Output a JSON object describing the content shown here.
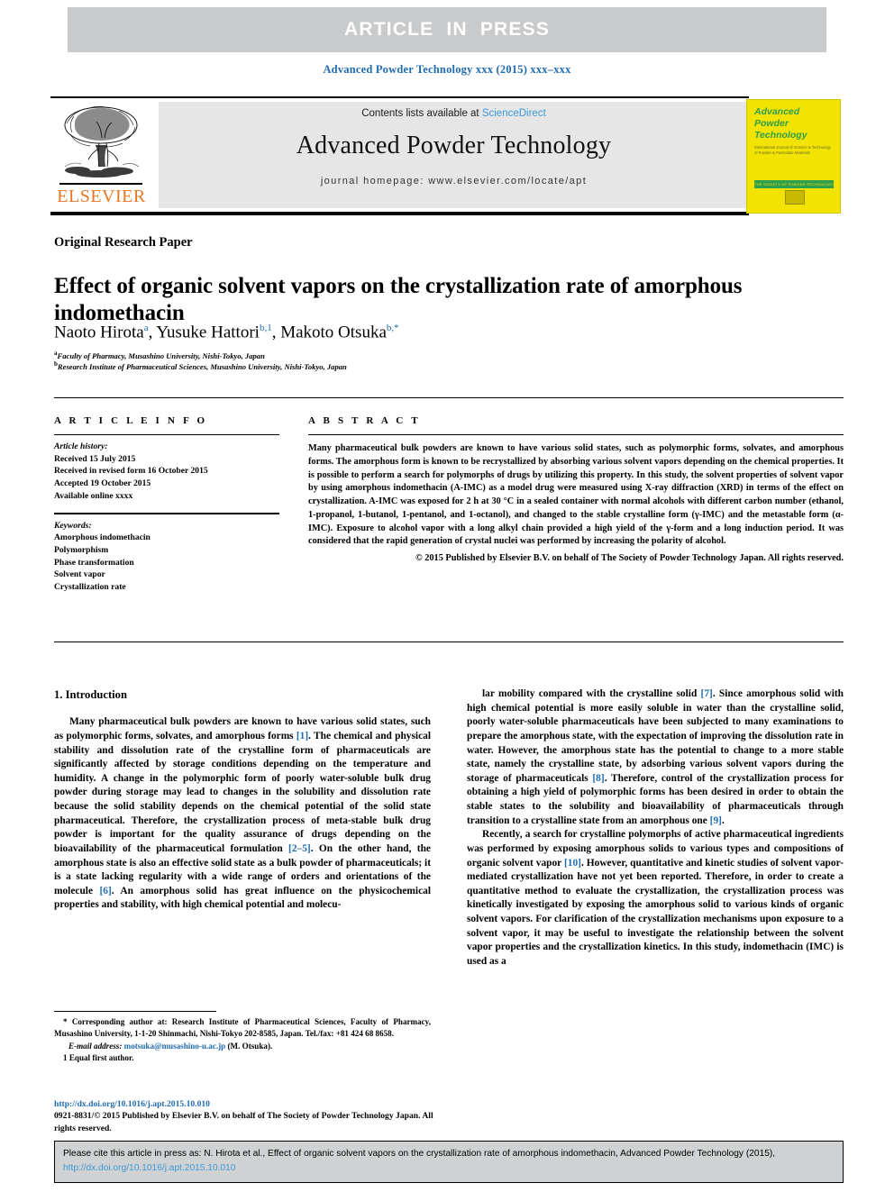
{
  "banner": {
    "text": "ARTICLE IN PRESS",
    "bg_color": "#c8cacb"
  },
  "running_head": "Advanced Powder Technology xxx (2015) xxx–xxx",
  "masthead": {
    "contents_prefix": "Contents lists available at ",
    "sciencedirect": "ScienceDirect",
    "journal_title": "Advanced Powder Technology",
    "homepage": "journal homepage: www.elsevier.com/locate/apt",
    "publisher_logo_word": "ELSEVIER",
    "publisher_color": "#e87722"
  },
  "cover": {
    "title_line1": "Advanced",
    "title_line2": "Powder",
    "title_line3": "Technology",
    "subtitle": "International Journal of Science & Technology of Powder & Particulate Materials",
    "band_text": "THE SOCIETY OF POWDER TECHNOLOGY JAPAN",
    "bg_color": "#f2e400",
    "accent_color": "#2e9e4f"
  },
  "article": {
    "kicker": "Original Research Paper",
    "title": "Effect of organic solvent vapors on the crystallization rate of amorphous indomethacin",
    "authors": [
      {
        "name": "Naoto Hirota",
        "marks": "a"
      },
      {
        "name": "Yusuke Hattori",
        "marks": "b,1"
      },
      {
        "name": "Makoto Otsuka",
        "marks": "b,*"
      }
    ],
    "affiliations": [
      {
        "mark": "a",
        "text": "Faculty of Pharmacy, Musashino University, Nishi-Tokyo, Japan"
      },
      {
        "mark": "b",
        "text": "Research Institute of Pharmaceutical Sciences, Musashino University, Nishi-Tokyo, Japan"
      }
    ]
  },
  "info": {
    "heading": "A R T I C L E   I N F O",
    "history_label": "Article history:",
    "history": [
      "Received 15 July 2015",
      "Received in revised form 16 October 2015",
      "Accepted 19 October 2015",
      "Available online xxxx"
    ],
    "keywords_label": "Keywords:",
    "keywords": [
      "Amorphous indomethacin",
      "Polymorphism",
      "Phase transformation",
      "Solvent vapor",
      "Crystallization rate"
    ]
  },
  "abstract": {
    "heading": "A B S T R A C T",
    "body": "Many pharmaceutical bulk powders are known to have various solid states, such as polymorphic forms, solvates, and amorphous forms. The amorphous form is known to be recrystallized by absorbing various solvent vapors depending on the chemical properties. It is possible to perform a search for polymorphs of drugs by utilizing this property. In this study, the solvent properties of solvent vapor by using amorphous indomethacin (A-IMC) as a model drug were measured using X-ray diffraction (XRD) in terms of the effect on crystallization. A-IMC was exposed for 2 h at 30 °C in a sealed container with normal alcohols with different carbon number (ethanol, 1-propanol, 1-butanol, 1-pentanol, and 1-octanol), and changed to the stable crystalline form (γ-IMC) and the metastable form (α-IMC). Exposure to alcohol vapor with a long alkyl chain provided a high yield of the γ-form and a long induction period. It was considered that the rapid generation of crystal nuclei was performed by increasing the polarity of alcohol.",
    "copyright": "© 2015 Published by Elsevier B.V. on behalf of The Society of Powder Technology Japan. All rights reserved."
  },
  "body": {
    "section_heading": "1. Introduction",
    "left_paragraph_1": "Many pharmaceutical bulk powders are known to have various solid states, such as polymorphic forms, solvates, and amorphous forms [1]. The chemical and physical stability and dissolution rate of the crystalline form of pharmaceuticals are significantly affected by storage conditions depending on the temperature and humidity. A change in the polymorphic form of poorly water-soluble bulk drug powder during storage may lead to changes in the solubility and dissolution rate because the solid stability depends on the chemical potential of the solid state pharmaceutical. Therefore, the crystallization process of meta-stable bulk drug powder is important for the quality assurance of drugs depending on the bioavailability of the pharmaceutical formulation [2–5]. On the other hand, the amorphous state is also an effective solid state as a bulk powder of pharmaceuticals; it is a state lacking regularity with a wide range of orders and orientations of the molecule [6]. An amorphous solid has great influence on the physicochemical properties and stability, with high chemical potential and molecu-",
    "right_paragraph_1": "lar mobility compared with the crystalline solid [7]. Since amorphous solid with high chemical potential is more easily soluble in water than the crystalline solid, poorly water-soluble pharmaceuticals have been subjected to many examinations to prepare the amorphous state, with the expectation of improving the dissolution rate in water. However, the amorphous state has the potential to change to a more stable state, namely the crystalline state, by adsorbing various solvent vapors during the storage of pharmaceuticals [8]. Therefore, control of the crystallization process for obtaining a high yield of polymorphic forms has been desired in order to obtain the stable states to the solubility and bioavailability of pharmaceuticals through transition to a crystalline state from an amorphous one [9].",
    "right_paragraph_2": "Recently, a search for crystalline polymorphs of active pharmaceutical ingredients was performed by exposing amorphous solids to various types and compositions of organic solvent vapor [10]. However, quantitative and kinetic studies of solvent vapor-mediated crystallization have not yet been reported. Therefore, in order to create a quantitative method to evaluate the crystallization, the crystallization process was kinetically investigated by exposing the amorphous solid to various kinds of organic solvent vapors. For clarification of the crystallization mechanisms upon exposure to a solvent vapor, it may be useful to investigate the relationship between the solvent vapor properties and the crystallization kinetics. In this study, indomethacin (IMC) is used as a"
  },
  "footnotes": {
    "corresponding": "* Corresponding author at: Research Institute of Pharmaceutical Sciences, Faculty of Pharmacy, Musashino University, 1-1-20 Shinmachi, Nishi-Tokyo 202-8585, Japan. Tel./fax: +81 424 68 8658.",
    "email_label": "E-mail address:",
    "email": "motsuka@musashino-u.ac.jp",
    "email_suffix": "(M. Otsuka).",
    "equal_first": "1  Equal first author."
  },
  "footer": {
    "doi": "http://dx.doi.org/10.1016/j.apt.2015.10.010",
    "issn_line": "0921-8831/© 2015 Published by Elsevier B.V. on behalf of The Society of Powder Technology Japan. All rights reserved."
  },
  "citation_box": {
    "text_before": "Please cite this article in press as: N. Hirota et al., Effect of organic solvent vapors on the crystallization rate of amorphous indomethacin, Advanced Powder Technology (2015), ",
    "link": "http://dx.doi.org/10.1016/j.apt.2015.10.010",
    "bg_color": "#d0d2d3"
  }
}
